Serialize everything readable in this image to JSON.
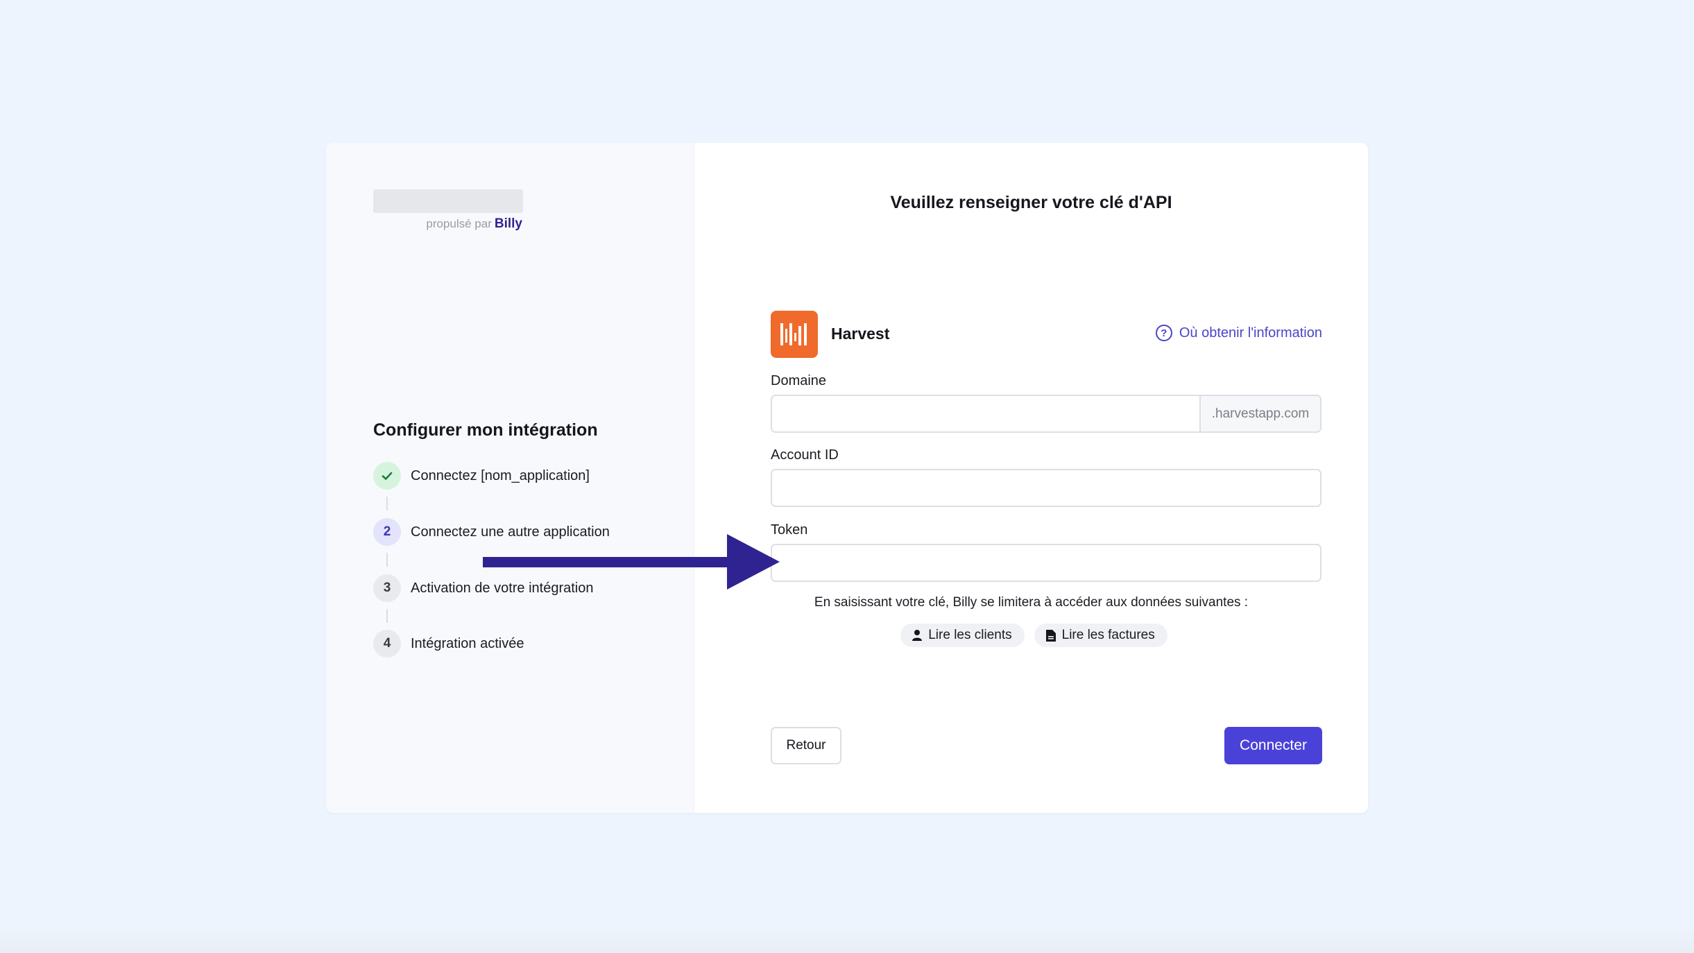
{
  "branding": {
    "powered_by_label": "propulsé par",
    "brand_name": "Billy"
  },
  "steps": {
    "title": "Configurer mon intégration",
    "items": [
      {
        "marker": "✓",
        "label": "Connectez [nom_application]",
        "state": "done"
      },
      {
        "marker": "2",
        "label": "Connectez une autre application",
        "state": "active"
      },
      {
        "marker": "3",
        "label": "Activation de votre intégration",
        "state": "todo"
      },
      {
        "marker": "4",
        "label": "Intégration activée",
        "state": "todo"
      }
    ]
  },
  "form": {
    "title": "Veuillez renseigner votre clé d'API",
    "app_name": "Harvest",
    "app_logo_icon": "harvest-logo-icon",
    "help_link": "Où obtenir l'information",
    "domain_label": "Domaine",
    "domain_value": "",
    "domain_suffix": ".harvestapp.com",
    "account_id_label": "Account ID",
    "account_id_value": "",
    "token_label": "Token",
    "token_value": "",
    "scope_text": "En saisissant votre clé, Billy se limitera à accéder aux données suivantes :",
    "scopes": [
      {
        "icon": "user-icon",
        "label": "Lire les clients"
      },
      {
        "icon": "document-icon",
        "label": "Lire les factures"
      }
    ],
    "back_button": "Retour",
    "connect_button": "Connecter"
  },
  "colors": {
    "accent": "#4a42d8",
    "annotation_arrow": "#2f2391",
    "app_logo": "#f06a2b",
    "background": "#eef4fd"
  }
}
